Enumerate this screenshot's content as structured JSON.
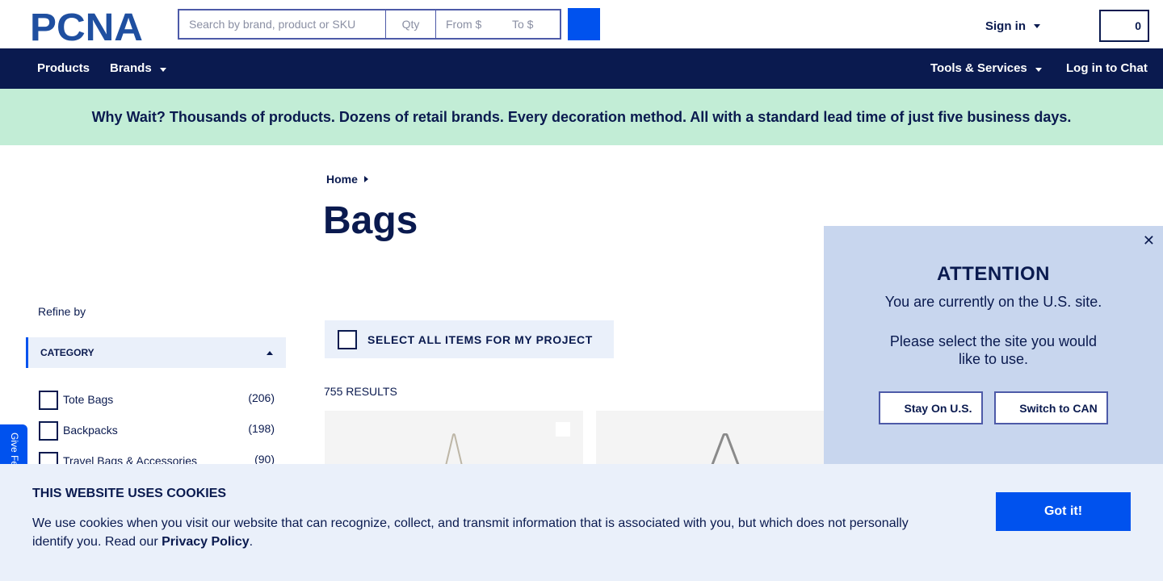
{
  "header": {
    "logo_text": "PCNA",
    "search_placeholder": "Search by brand, product or SKU",
    "qty_placeholder": "Qty",
    "from_placeholder": "From $",
    "to_placeholder": "To $",
    "signin_label": "Sign in",
    "cart_count": "0"
  },
  "nav": {
    "products": "Products",
    "brands": "Brands",
    "tools_services": "Tools & Services",
    "chat": "Log in to Chat"
  },
  "promo": {
    "text": "Why Wait? Thousands of products. Dozens of retail brands. Every decoration method. All with a standard lead time of just five business days."
  },
  "breadcrumb": {
    "home": "Home"
  },
  "page": {
    "title": "Bags"
  },
  "sidebar": {
    "refine_label": "Refine by",
    "category_header": "CATEGORY",
    "categories": [
      {
        "label": "Tote Bags",
        "count": "(206)"
      },
      {
        "label": "Backpacks",
        "count": "(198)"
      },
      {
        "label": "Travel Bags & Accessories",
        "count": "(90)"
      }
    ],
    "feedback_label": "Give Feedback"
  },
  "results": {
    "select_all_label": "SELECT ALL ITEMS FOR MY PROJECT",
    "count_label": "755 RESULTS"
  },
  "attention": {
    "title": "ATTENTION",
    "message": "You are currently on the U.S. site.",
    "select_message": "Please select the site you would like to use.",
    "stay_label": "Stay On U.S.",
    "switch_label": "Switch to CAN"
  },
  "cookie": {
    "title": "THIS WEBSITE USES COOKIES",
    "text": "We use cookies when you visit our website that can recognize, collect, and transmit information that is associated with you, but which does not personally identify you. Read our ",
    "link": "Privacy Policy",
    "text_end": ".",
    "button": "Got it!"
  },
  "colors": {
    "navy": "#0a1a4f",
    "blue": "#0052ee",
    "promo_green": "#c2edd6",
    "panel_blue": "#c8d6ee",
    "light_blue": "#eaf0fa"
  },
  "icons": {
    "search": "search-icon",
    "caret": "chevron-down-icon",
    "close": "close-icon"
  }
}
